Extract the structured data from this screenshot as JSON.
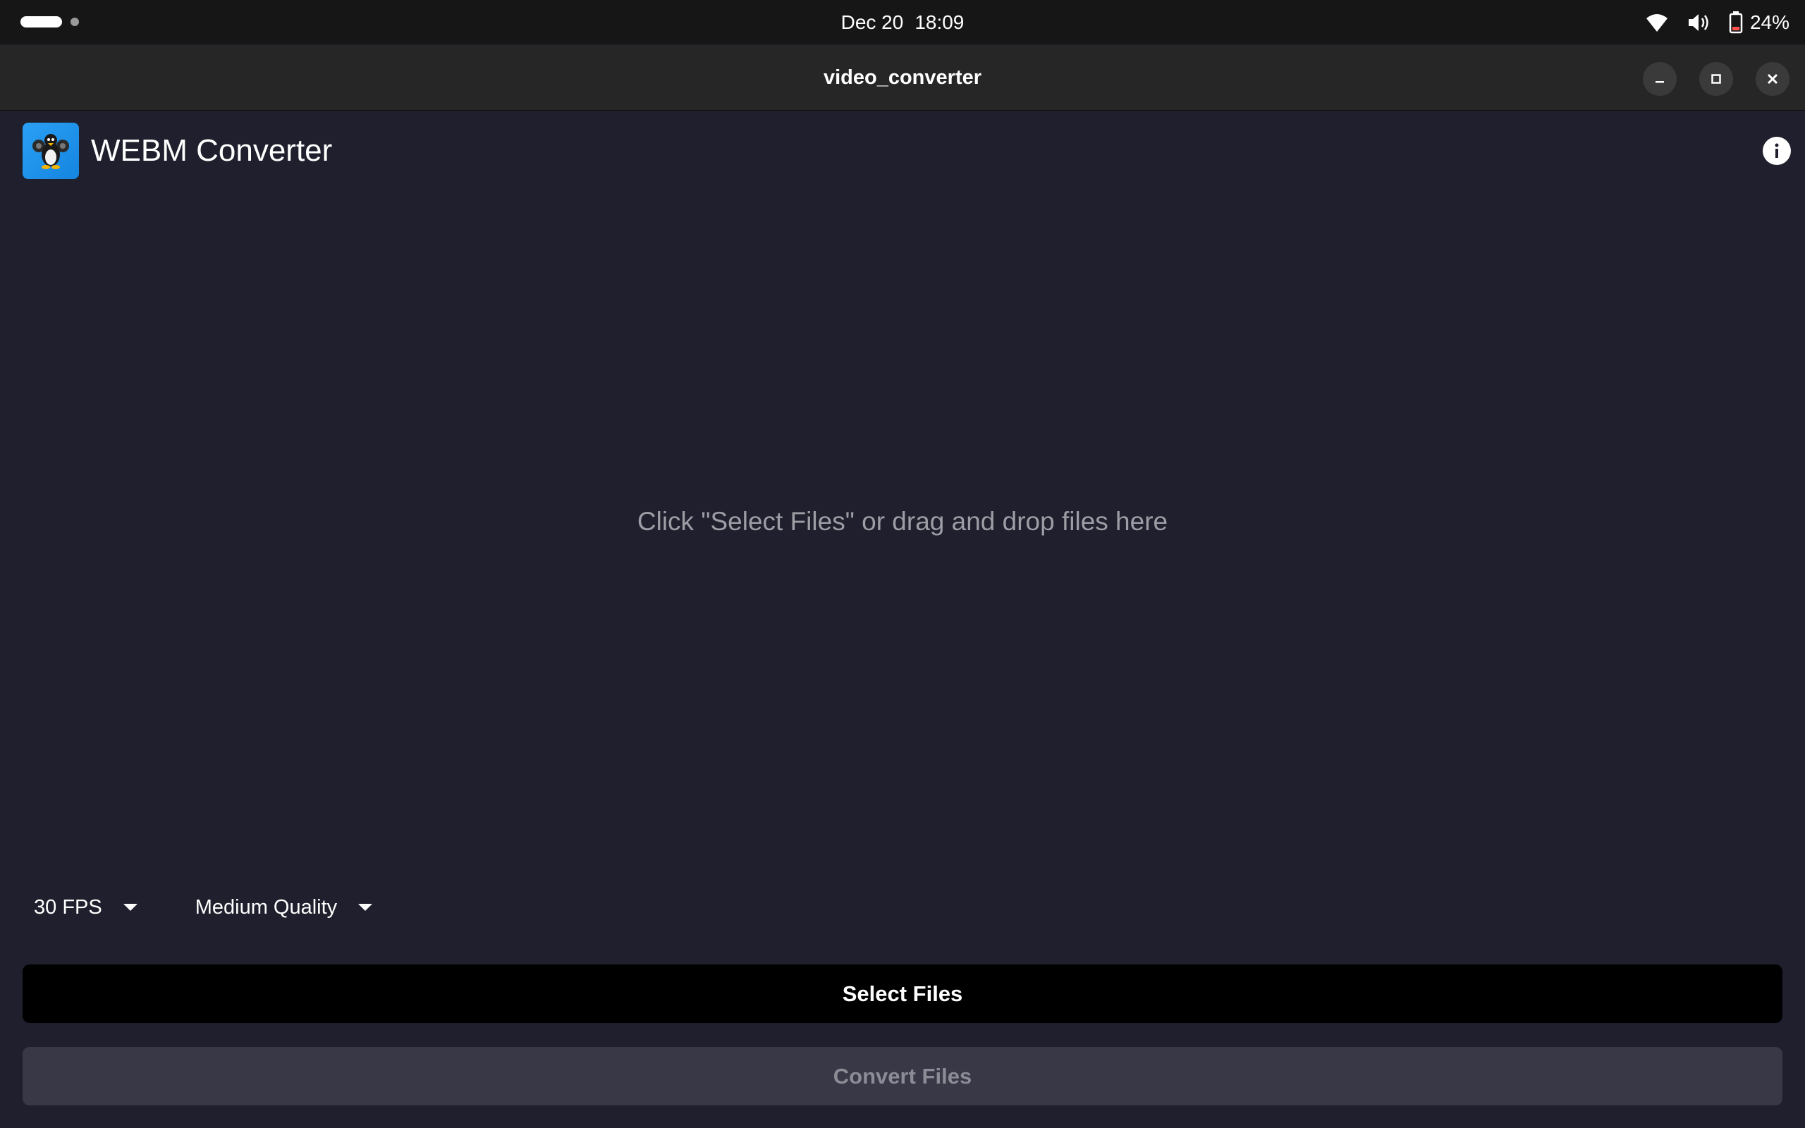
{
  "system_bar": {
    "date": "Dec 20",
    "time": "18:09",
    "battery_percent": "24%",
    "icons": [
      "wifi-icon",
      "volume-icon",
      "battery-icon"
    ]
  },
  "window": {
    "title": "video_converter",
    "controls": [
      "minimize",
      "maximize",
      "close"
    ]
  },
  "app": {
    "title": "WEBM Converter",
    "logo_icon": "tux-penguin-logo",
    "info_icon": "info-icon"
  },
  "drop_zone": {
    "hint": "Click \"Select Files\" or drag and drop files here"
  },
  "options": {
    "fps": {
      "selected": "30 FPS"
    },
    "quality": {
      "selected": "Medium Quality"
    }
  },
  "actions": {
    "select_label": "Select Files",
    "convert_label": "Convert Files",
    "convert_enabled": false
  },
  "colors": {
    "background": "#1f1f2d",
    "topbar": "#161616",
    "headerbar": "#262626",
    "primary_button": "#000000",
    "disabled_button": "#383847",
    "logo_blue": "#1e90ec"
  }
}
